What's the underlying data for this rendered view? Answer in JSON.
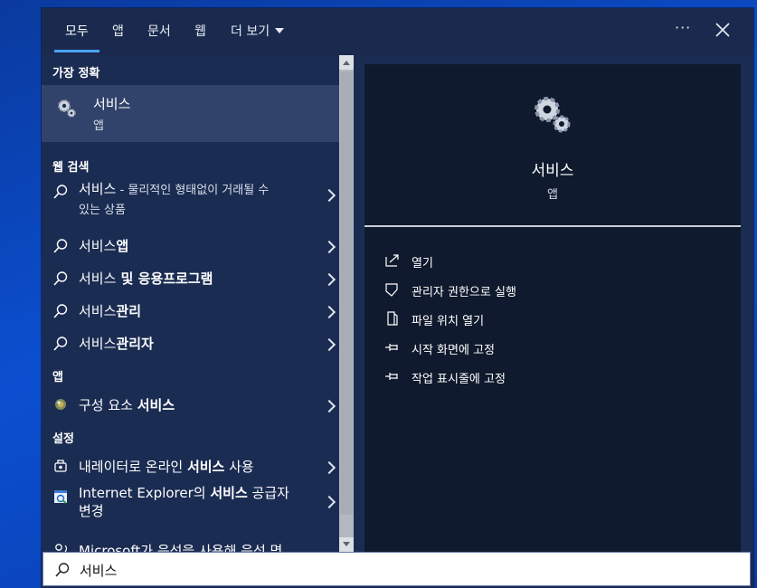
{
  "tabs": [
    {
      "label": "모두",
      "active": true
    },
    {
      "label": "앱"
    },
    {
      "label": "문서"
    },
    {
      "label": "웹"
    },
    {
      "label": "더 보기"
    }
  ],
  "topbar": {
    "ellipsis": "···",
    "close_icon": "close-icon"
  },
  "left": {
    "best_match_header": "가장 정확",
    "best_match": {
      "title": "서비스",
      "subtitle": "앱",
      "icon": "gears-icon"
    },
    "web_header": "웹 검색",
    "web_results": [
      {
        "term": "서비스",
        "suffix": " - 물리적인 형태없이 거래될 수",
        "suffix2": "있는 상품"
      },
      {
        "term": "서비스",
        "bold": "앱"
      },
      {
        "term": "서비스",
        "bold": " 및 응용프로그램"
      },
      {
        "term": "서비스",
        "bold": "관리"
      },
      {
        "term": "서비스",
        "bold": "관리자"
      }
    ],
    "apps_header": "앱",
    "apps": [
      {
        "pre": "구성 요소 ",
        "bold": "서비스",
        "icon": "component-services-icon"
      }
    ],
    "settings_header": "설정",
    "settings": [
      {
        "pre": "내레이터로 온라인 ",
        "bold": "서비스",
        "post": " 사용",
        "icon": "narrator-icon"
      },
      {
        "pre": "Internet Explorer의 ",
        "bold": "서비스",
        "post": " 공급자",
        "line2": "변경",
        "icon": "internet-options-icon"
      },
      {
        "pre": "Microsoft가 음성을 사용해 음성 명",
        "icon": "speech-icon"
      }
    ]
  },
  "right": {
    "title": "서비스",
    "subtitle": "앱",
    "actions": [
      {
        "label": "열기",
        "icon": "open-icon"
      },
      {
        "label": "관리자 권한으로 실행",
        "icon": "shield-icon"
      },
      {
        "label": "파일 위치 열기",
        "icon": "file-location-icon"
      },
      {
        "label": "시작 화면에 고정",
        "icon": "pin-icon"
      },
      {
        "label": "작업 표시줄에 고정",
        "icon": "pin-taskbar-icon"
      }
    ]
  },
  "search": {
    "value": "서비스",
    "icon": "search-icon"
  },
  "colors": {
    "accent": "#4aa3ff",
    "panel": "#1b2c52",
    "preview": "#101a2e",
    "selected": "#31436a"
  }
}
